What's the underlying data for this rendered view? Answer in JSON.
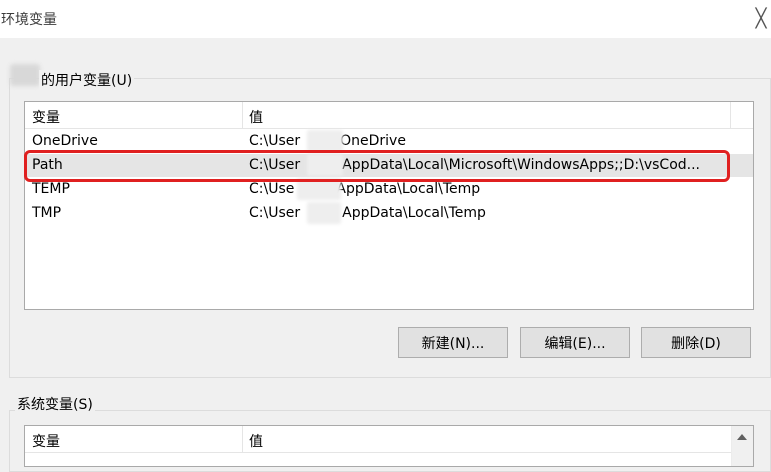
{
  "window": {
    "title": "环境变量",
    "close_glyph": "╳"
  },
  "user_vars": {
    "group_label": "的用户变量(U)",
    "columns": [
      "变量",
      "值"
    ],
    "rows": [
      {
        "name": "OneDrive",
        "value_prefix": "C:\\User",
        "value_suffix": "OneDrive"
      },
      {
        "name": "Path",
        "value_prefix": "C:\\User",
        "value_suffix": "AppData\\Local\\Microsoft\\WindowsApps;;D:\\vsCod..."
      },
      {
        "name": "TEMP",
        "value_prefix": "C:\\Use",
        "value_suffix": "AppData\\Local\\Temp"
      },
      {
        "name": "TMP",
        "value_prefix": "C:\\User",
        "value_suffix": "AppData\\Local\\Temp"
      }
    ],
    "selected_row": "Path",
    "buttons": {
      "new": "新建(N)...",
      "edit": "编辑(E)...",
      "delete": "删除(D)"
    }
  },
  "system_vars": {
    "group_label": "系统变量(S)",
    "columns": [
      "变量",
      "值"
    ]
  },
  "colors": {
    "highlight": "#e02020",
    "selection": "#e5e5e5"
  }
}
